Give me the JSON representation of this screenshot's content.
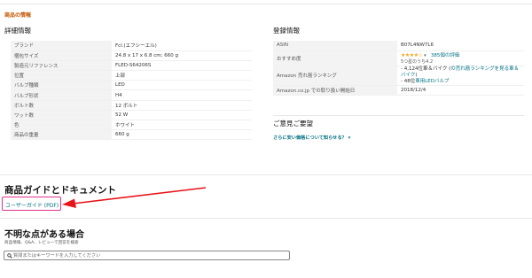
{
  "header": {
    "section_label": "商品の情報"
  },
  "details": {
    "title": "詳細情報",
    "rows": [
      {
        "k": "ブランド",
        "v": "Fcl.(エフシーエル)"
      },
      {
        "k": "梱包サイズ",
        "v": "24.8 x 17 x 6.8 cm; 660 g"
      },
      {
        "k": "製造元リファレンス",
        "v": "FLED-S64206S"
      },
      {
        "k": "位置",
        "v": "上部"
      },
      {
        "k": "バルブ種類",
        "v": "LED"
      },
      {
        "k": "バルブ形状",
        "v": "H4"
      },
      {
        "k": "ボルト数",
        "v": "12 ボルト"
      },
      {
        "k": "ワット数",
        "v": "52 W"
      },
      {
        "k": "色",
        "v": "ホワイト"
      },
      {
        "k": "商品の重量",
        "v": "660 g"
      }
    ]
  },
  "registration": {
    "title": "登録情報",
    "asin_label": "ASIN",
    "asin_value": "B07L4NW7L6",
    "reco_label": "おすすめ度",
    "stars": "★★★★☆",
    "stars_caret": "▾",
    "review_count": "385個の評価",
    "rating_text": "5つ星のうち4.2",
    "rank_label": "Amazon 売れ筋ランキング",
    "rank_line1_prefix": "- 4,124位車＆バイク (",
    "rank_line1_link": "の売れ筋ランキングを見る車＆バイク",
    "rank_line1_suffix": ")",
    "rank_line2_prefix": "- 48位",
    "rank_line2_link": "車用LEDバルブ",
    "date_label": "Amazon.co.jp での取り扱い開始日",
    "date_value": "2018/12/4"
  },
  "feedback": {
    "title": "ご意見ご要望",
    "link": "さらに安い価格について知らせる？",
    "caret": "▾"
  },
  "guide": {
    "title": "商品ガイドとドキュメント",
    "link": "ユーザーガイド (PDF)",
    "highlight_color": "#e0338f",
    "arrow_color": "#e8141b"
  },
  "qa": {
    "title": "不明な点がある場合",
    "subtitle": "商品情報、Q&A、レビューで回答を検索",
    "search_placeholder": "質問またはキーワードを入力してください"
  }
}
